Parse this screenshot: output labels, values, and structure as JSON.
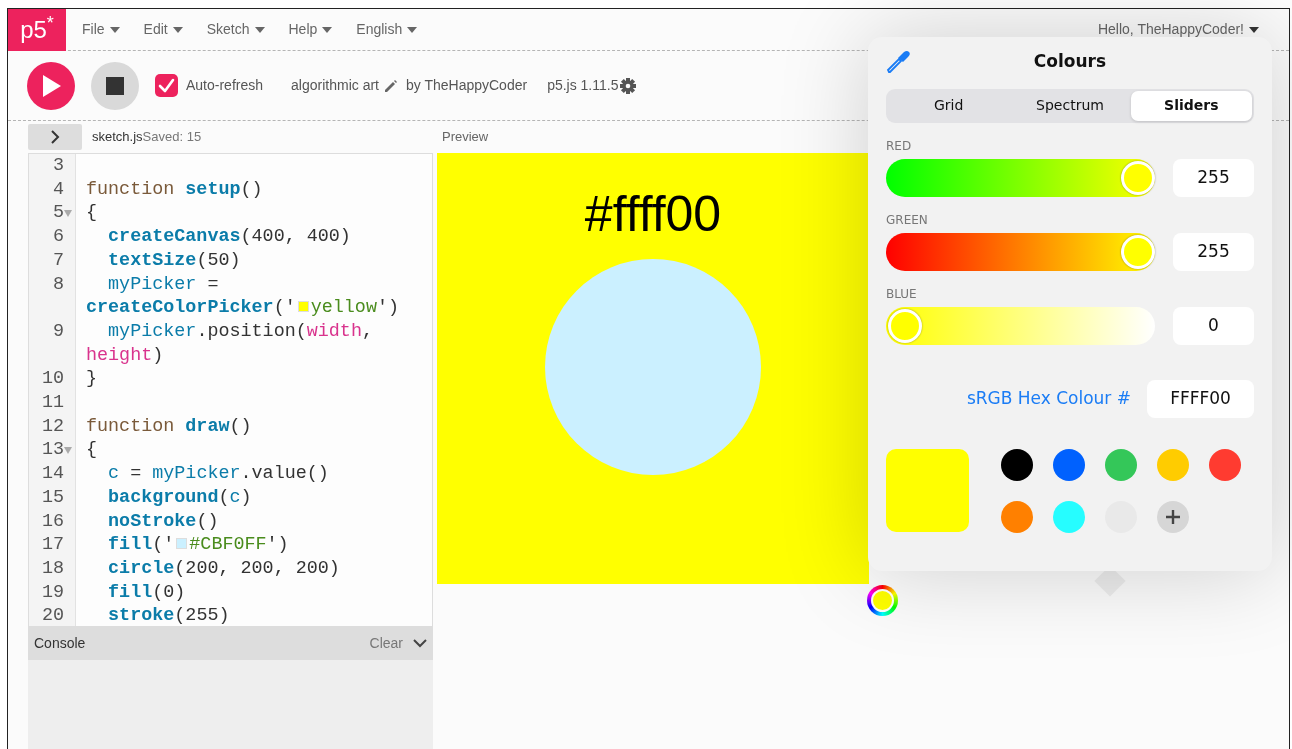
{
  "menu_bar": {
    "logo": "p5$^{*}$",
    "menus": [
      "File",
      "Edit",
      "Sketch",
      "Help",
      "English"
    ],
    "user_menu": "Hello, TheHappyCoder!"
  },
  "toolbar": {
    "auto_refresh": {
      "label": "Auto-refresh",
      "checked": true
    },
    "sketch_name": "algorithmic art",
    "author": "by TheHappyCoder",
    "version": "p5.js 1.11.5"
  },
  "editor": {
    "file_name": "sketch.js",
    "saved_status": "Saved: 15",
    "lines": [
      {
        "number": "3",
        "foldable": false
      },
      {
        "number": "4",
        "foldable": false,
        "tokens": [
          {
            "kind": "kw",
            "text": "function "
          },
          {
            "kind": "def",
            "text": "setup"
          },
          {
            "kind": "plain",
            "text": "()"
          }
        ]
      },
      {
        "number": "5",
        "foldable": true,
        "tokens": [
          {
            "kind": "plain",
            "text": "{"
          }
        ]
      },
      {
        "number": "6",
        "foldable": false,
        "tokens": [
          {
            "kind": "builtin",
            "text": "  createCanvas"
          },
          {
            "kind": "plain",
            "text": "("
          },
          {
            "kind": "num",
            "text": "400"
          },
          {
            "kind": "plain",
            "text": ", "
          },
          {
            "kind": "num",
            "text": "400"
          },
          {
            "kind": "plain",
            "text": ")"
          }
        ]
      },
      {
        "number": "7",
        "foldable": false,
        "tokens": [
          {
            "kind": "builtin",
            "text": "  textSize"
          },
          {
            "kind": "plain",
            "text": "("
          },
          {
            "kind": "num",
            "text": "50"
          },
          {
            "kind": "plain",
            "text": ")"
          }
        ]
      },
      {
        "number": "8",
        "foldable": false,
        "tokens": [
          {
            "kind": "var",
            "text": "  myPicker"
          },
          {
            "kind": "plain",
            "text": " = "
          },
          {
            "kind": "builtin",
            "text": "createColorPicker"
          },
          {
            "kind": "plain",
            "text": "('"
          },
          {
            "kind": "swatch",
            "color": "#ffff00"
          },
          {
            "kind": "str",
            "text": "yellow"
          },
          {
            "kind": "plain",
            "text": "')"
          }
        ]
      },
      {
        "number": "9",
        "foldable": false,
        "tokens": [
          {
            "kind": "var",
            "text": "  myPicker"
          },
          {
            "kind": "plain",
            "text": ".position("
          },
          {
            "kind": "prop",
            "text": "width"
          },
          {
            "kind": "plain",
            "text": ", "
          },
          {
            "kind": "prop",
            "text": "height"
          },
          {
            "kind": "plain",
            "text": ")"
          }
        ]
      },
      {
        "number": "10",
        "foldable": false,
        "tokens": [
          {
            "kind": "plain",
            "text": "}"
          }
        ]
      },
      {
        "number": "11",
        "foldable": false
      },
      {
        "number": "12",
        "foldable": false,
        "tokens": [
          {
            "kind": "kw",
            "text": "function "
          },
          {
            "kind": "def",
            "text": "draw"
          },
          {
            "kind": "plain",
            "text": "()"
          }
        ]
      },
      {
        "number": "13",
        "foldable": true,
        "tokens": [
          {
            "kind": "plain",
            "text": "{"
          }
        ]
      },
      {
        "number": "14",
        "foldable": false,
        "tokens": [
          {
            "kind": "var",
            "text": "  c"
          },
          {
            "kind": "plain",
            "text": " = "
          },
          {
            "kind": "var",
            "text": "myPicker"
          },
          {
            "kind": "plain",
            "text": ".value()"
          }
        ]
      },
      {
        "number": "15",
        "foldable": false,
        "tokens": [
          {
            "kind": "builtin",
            "text": "  background"
          },
          {
            "kind": "plain",
            "text": "("
          },
          {
            "kind": "var",
            "text": "c"
          },
          {
            "kind": "plain",
            "text": ")"
          }
        ]
      },
      {
        "number": "16",
        "foldable": false,
        "tokens": [
          {
            "kind": "builtin",
            "text": "  noStroke"
          },
          {
            "kind": "plain",
            "text": "()"
          }
        ]
      },
      {
        "number": "17",
        "foldable": false,
        "tokens": [
          {
            "kind": "builtin",
            "text": "  fill"
          },
          {
            "kind": "plain",
            "text": "('"
          },
          {
            "kind": "swatch",
            "color": "#cbf0ff"
          },
          {
            "kind": "str",
            "text": "#CBF0FF"
          },
          {
            "kind": "plain",
            "text": "')"
          }
        ]
      },
      {
        "number": "18",
        "foldable": false,
        "tokens": [
          {
            "kind": "builtin",
            "text": "  circle"
          },
          {
            "kind": "plain",
            "text": "("
          },
          {
            "kind": "num",
            "text": "200"
          },
          {
            "kind": "plain",
            "text": ", "
          },
          {
            "kind": "num",
            "text": "200"
          },
          {
            "kind": "plain",
            "text": ", "
          },
          {
            "kind": "num",
            "text": "200"
          },
          {
            "kind": "plain",
            "text": ")"
          }
        ]
      },
      {
        "number": "19",
        "foldable": false,
        "tokens": [
          {
            "kind": "builtin",
            "text": "  fill"
          },
          {
            "kind": "plain",
            "text": "("
          },
          {
            "kind": "num",
            "text": "0"
          },
          {
            "kind": "plain",
            "text": ")"
          }
        ]
      },
      {
        "number": "20",
        "foldable": false,
        "tokens": [
          {
            "kind": "builtin",
            "text": "  stroke"
          },
          {
            "kind": "plain",
            "text": "("
          },
          {
            "kind": "num",
            "text": "255"
          },
          {
            "kind": "plain",
            "text": ")"
          }
        ]
      }
    ]
  },
  "console": {
    "title": "Console",
    "clear_label": "Clear"
  },
  "preview": {
    "label": "Preview",
    "canvas_text": "#ffff00"
  },
  "color_panel": {
    "title": "Colours",
    "tabs": [
      {
        "label": "Grid",
        "selected": false
      },
      {
        "label": "Spectrum",
        "selected": false
      },
      {
        "label": "Sliders",
        "selected": true
      }
    ],
    "channels": [
      {
        "name": "RED",
        "level": 1,
        "value": "255"
      },
      {
        "name": "GREEN",
        "level": 1,
        "value": "255"
      },
      {
        "name": "BLUE",
        "level": 0,
        "value": "0"
      }
    ],
    "hex_label": "sRGB Hex Colour #",
    "hex_value": "FFFF00",
    "swatches": [
      {
        "kind": "color",
        "color": "#000000"
      },
      {
        "kind": "color",
        "color": "#0061fe"
      },
      {
        "kind": "color",
        "color": "#34c759"
      },
      {
        "kind": "color",
        "color": "#ffcc00"
      },
      {
        "kind": "color",
        "color": "#ff3b30"
      },
      {
        "kind": "color",
        "color": "#ff8000"
      },
      {
        "kind": "color",
        "color": "#26fdff"
      },
      {
        "kind": "color",
        "color": "#e9e9e9"
      },
      {
        "kind": "add"
      }
    ]
  }
}
